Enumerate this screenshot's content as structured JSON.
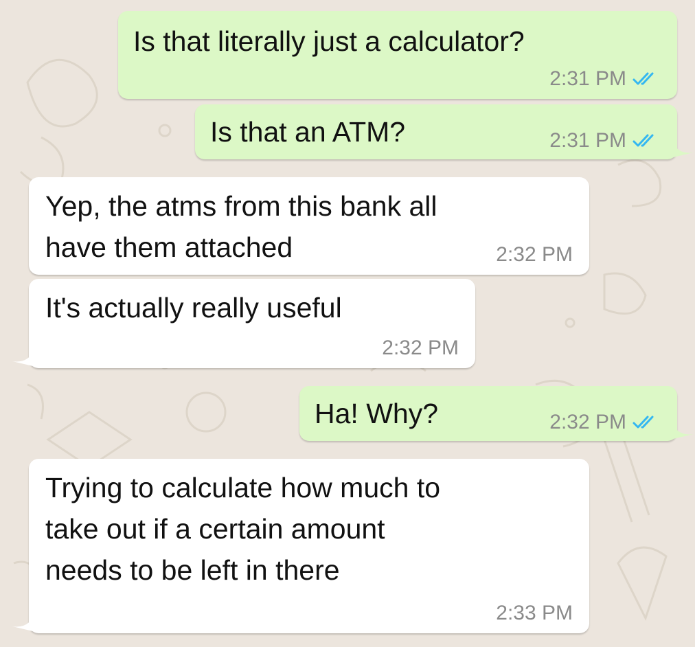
{
  "chat": {
    "messages": [
      {
        "direction": "outgoing",
        "text": "Is that literally just a calculator?",
        "time": "2:31 PM",
        "read_receipt": "double-check-blue"
      },
      {
        "direction": "outgoing",
        "text": "Is that an ATM?",
        "time": "2:31 PM",
        "read_receipt": "double-check-blue"
      },
      {
        "direction": "incoming",
        "text": "Yep, the atms from this bank all\nhave them attached",
        "time": "2:32 PM"
      },
      {
        "direction": "incoming",
        "text": "It's actually really useful",
        "time": "2:32 PM"
      },
      {
        "direction": "outgoing",
        "text": "Ha! Why?",
        "time": "2:32 PM",
        "read_receipt": "double-check-blue"
      },
      {
        "direction": "incoming",
        "text": "Trying to calculate how much to\ntake out if a certain amount\nneeds to be left in there",
        "time": "2:33 PM"
      }
    ]
  },
  "colors": {
    "background": "#ece5dd",
    "outgoing_bubble": "#dcf8c6",
    "incoming_bubble": "#ffffff",
    "read_tick": "#34b7f1",
    "timestamp": "#8a8a8a"
  }
}
